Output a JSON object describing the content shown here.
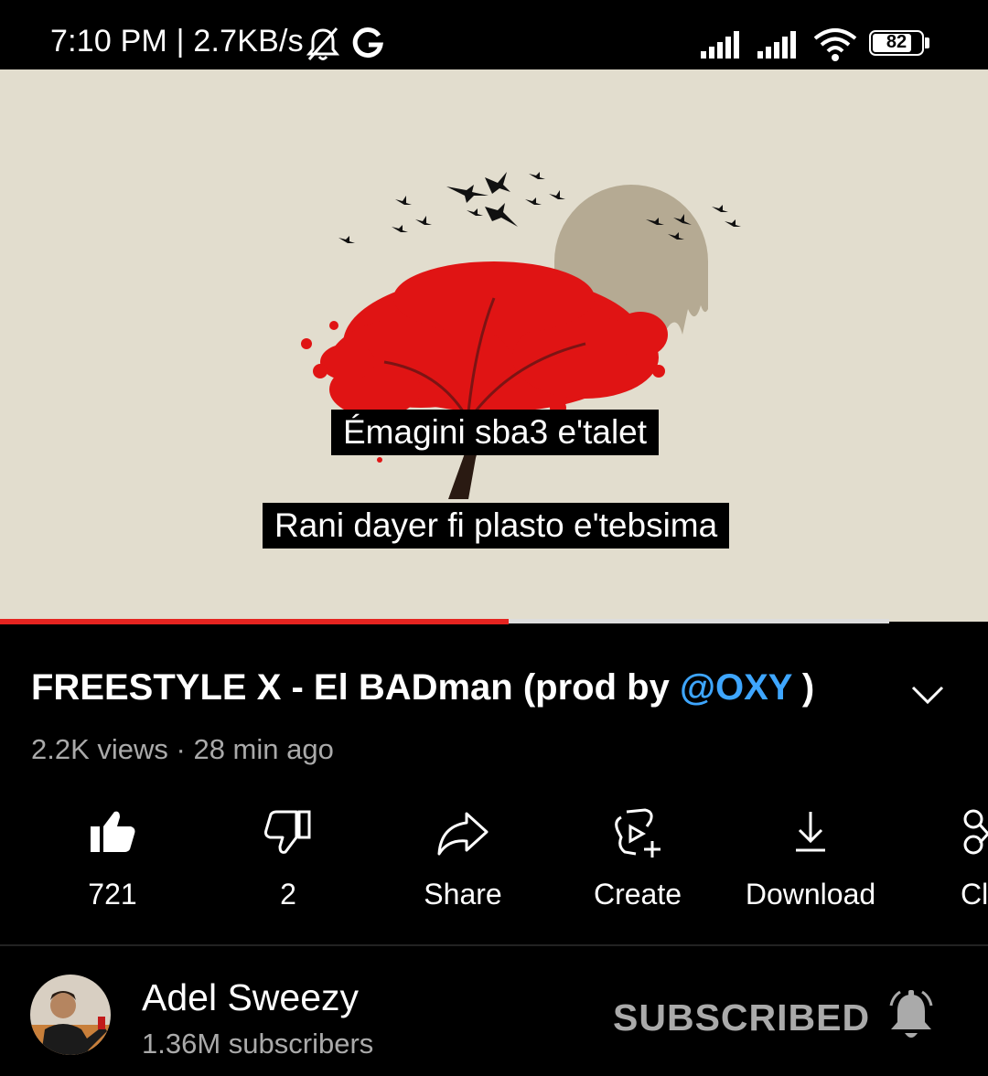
{
  "status_bar": {
    "text": "7:10 PM | 2.7KB/s",
    "battery": "82",
    "battery_level": 0.82,
    "icons": [
      "bell-off-icon",
      "g-icon",
      "signal-icon",
      "signal-icon",
      "wifi-icon",
      "battery-icon"
    ]
  },
  "video": {
    "captions": [
      "Émagini sba3 e'talet",
      "Rani dayer fi plasto e'tebsima"
    ],
    "progress": 0.515,
    "buffered": 0.9
  },
  "title": {
    "main": "FREESTYLE X - El BADman (prod by ",
    "mention": "@OXY",
    "end": " )"
  },
  "meta": "2.2K views · 28 min ago",
  "actions": [
    {
      "label": "721",
      "icon": "thumbs-up-icon"
    },
    {
      "label": "2",
      "icon": "thumbs-down-icon"
    },
    {
      "label": "Share",
      "icon": "share-icon"
    },
    {
      "label": "Create",
      "icon": "create-icon"
    },
    {
      "label": "Download",
      "icon": "download-icon"
    },
    {
      "label": "Cl",
      "icon": "clip-icon"
    }
  ],
  "channel": {
    "name": "Adel Sweezy",
    "subscribers": "1.36M subscribers",
    "button": "SUBSCRIBED",
    "bell_icon": "bell-icon"
  },
  "colors": {
    "progress": "#e52420",
    "mention": "#3ea6ff",
    "video_bg": "#e2ddce",
    "tree": "#e01414"
  }
}
